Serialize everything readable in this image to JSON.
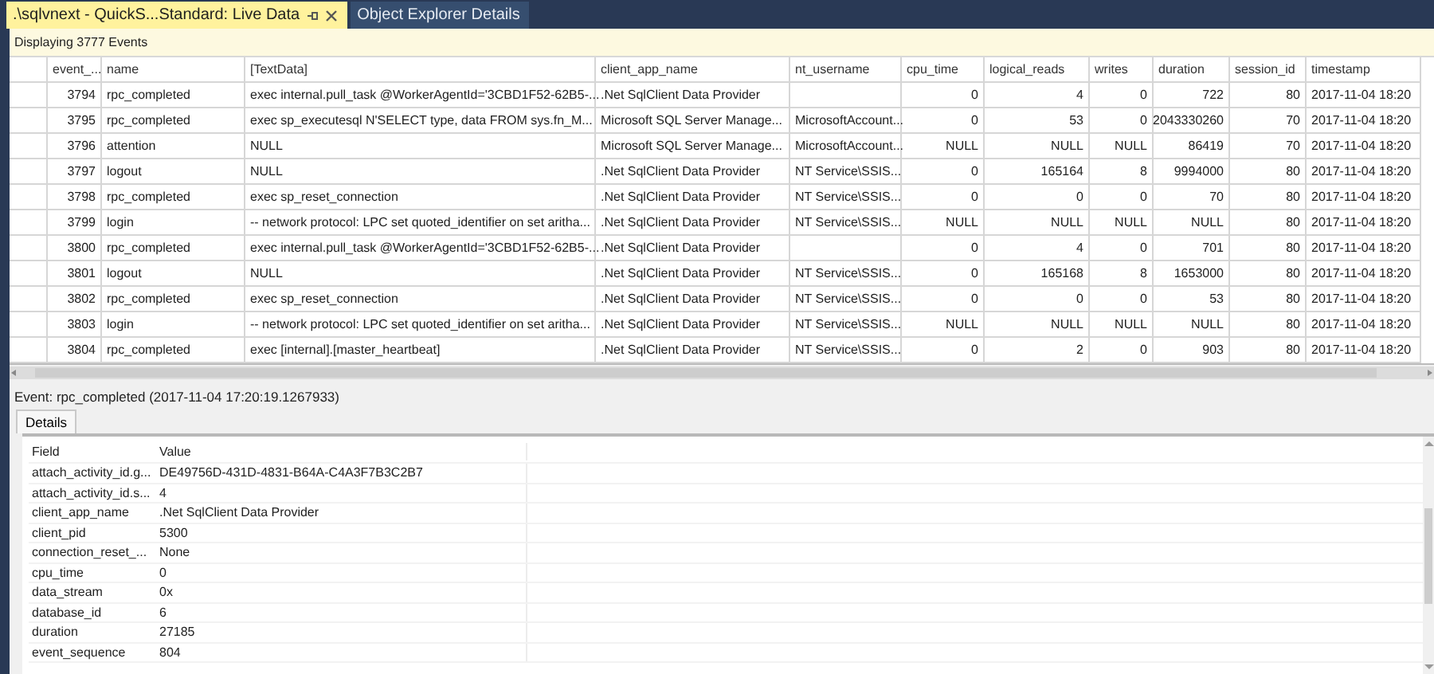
{
  "tabs": [
    {
      "label": ".\\sqlvnext - QuickS...Standard: Live Data",
      "selected": true
    },
    {
      "label": "Object Explorer Details",
      "selected": false
    }
  ],
  "info_bar": "Displaying 3777 Events",
  "events_table": {
    "columns": [
      {
        "label": "event_...",
        "kind": "number"
      },
      {
        "label": "name",
        "kind": "text"
      },
      {
        "label": "[TextData]",
        "kind": "text"
      },
      {
        "label": "client_app_name",
        "kind": "text"
      },
      {
        "label": "nt_username",
        "kind": "text"
      },
      {
        "label": "cpu_time",
        "kind": "number"
      },
      {
        "label": "logical_reads",
        "kind": "number"
      },
      {
        "label": "writes",
        "kind": "number"
      },
      {
        "label": "duration",
        "kind": "number"
      },
      {
        "label": "session_id",
        "kind": "number"
      },
      {
        "label": "timestamp",
        "kind": "text"
      }
    ],
    "rows": [
      [
        "3794",
        "rpc_completed",
        "exec internal.pull_task @WorkerAgentId='3CBD1F52-62B5-...",
        ".Net SqlClient Data Provider",
        "",
        "0",
        "4",
        "0",
        "722",
        "80",
        "2017-11-04 18:20"
      ],
      [
        "3795",
        "rpc_completed",
        "exec sp_executesql N'SELECT type, data FROM sys.fn_M...",
        "Microsoft SQL Server Manage...",
        "MicrosoftAccount...",
        "0",
        "53",
        "0",
        "2043330260",
        "70",
        "2017-11-04 18:20"
      ],
      [
        "3796",
        "attention",
        "NULL",
        "Microsoft SQL Server Manage...",
        "MicrosoftAccount...",
        "NULL",
        "NULL",
        "NULL",
        "86419",
        "70",
        "2017-11-04 18:20"
      ],
      [
        "3797",
        "logout",
        "NULL",
        ".Net SqlClient Data Provider",
        "NT Service\\SSIS...",
        "0",
        "165164",
        "8",
        "9994000",
        "80",
        "2017-11-04 18:20"
      ],
      [
        "3798",
        "rpc_completed",
        "exec sp_reset_connection",
        ".Net SqlClient Data Provider",
        "NT Service\\SSIS...",
        "0",
        "0",
        "0",
        "70",
        "80",
        "2017-11-04 18:20"
      ],
      [
        "3799",
        "login",
        "-- network protocol: LPC  set quoted_identifier on  set aritha...",
        ".Net SqlClient Data Provider",
        "NT Service\\SSIS...",
        "NULL",
        "NULL",
        "NULL",
        "NULL",
        "80",
        "2017-11-04 18:20"
      ],
      [
        "3800",
        "rpc_completed",
        "exec internal.pull_task @WorkerAgentId='3CBD1F52-62B5-...",
        ".Net SqlClient Data Provider",
        "",
        "0",
        "4",
        "0",
        "701",
        "80",
        "2017-11-04 18:20"
      ],
      [
        "3801",
        "logout",
        "NULL",
        ".Net SqlClient Data Provider",
        "NT Service\\SSIS...",
        "0",
        "165168",
        "8",
        "1653000",
        "80",
        "2017-11-04 18:20"
      ],
      [
        "3802",
        "rpc_completed",
        "exec sp_reset_connection",
        ".Net SqlClient Data Provider",
        "NT Service\\SSIS...",
        "0",
        "0",
        "0",
        "53",
        "80",
        "2017-11-04 18:20"
      ],
      [
        "3803",
        "login",
        "-- network protocol: LPC  set quoted_identifier on  set aritha...",
        ".Net SqlClient Data Provider",
        "NT Service\\SSIS...",
        "NULL",
        "NULL",
        "NULL",
        "NULL",
        "80",
        "2017-11-04 18:20"
      ],
      [
        "3804",
        "rpc_completed",
        "exec [internal].[master_heartbeat]",
        ".Net SqlClient Data Provider",
        "NT Service\\SSIS...",
        "0",
        "2",
        "0",
        "903",
        "80",
        "2017-11-04 18:20"
      ]
    ]
  },
  "event_title": "Event: rpc_completed (2017-11-04 17:20:19.1267933)",
  "detail_tabs": [
    {
      "label": "Details",
      "selected": true
    }
  ],
  "details_table": {
    "columns": [
      "Field",
      "Value"
    ],
    "rows": [
      [
        "attach_activity_id.g...",
        "DE49756D-431D-4831-B64A-C4A3F7B3C2B7"
      ],
      [
        "attach_activity_id.s...",
        "4"
      ],
      [
        "client_app_name",
        ".Net SqlClient Data Provider"
      ],
      [
        "client_pid",
        "5300"
      ],
      [
        "connection_reset_...",
        "None"
      ],
      [
        "cpu_time",
        "0"
      ],
      [
        "data_stream",
        "0x"
      ],
      [
        "database_id",
        "6"
      ],
      [
        "duration",
        "27185"
      ],
      [
        "event_sequence",
        "804"
      ]
    ]
  }
}
